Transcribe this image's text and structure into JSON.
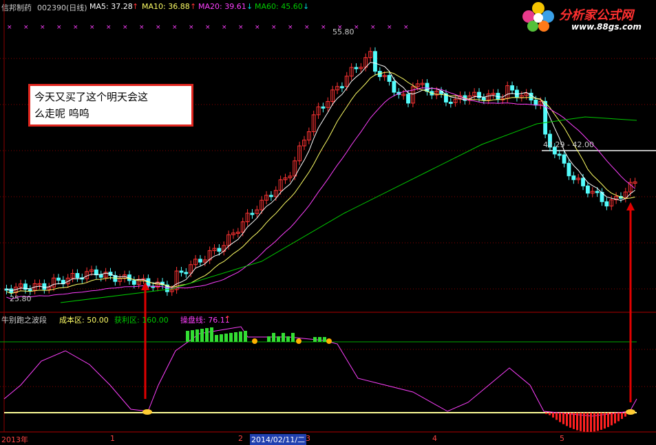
{
  "header": {
    "stock_name": "信邦制药",
    "stock_code": "002390(日线)",
    "ma5": "MA5: 37.28",
    "ma10": "MA10: 36.88",
    "ma20": "MA20: 39.61",
    "ma60": "MA60: 45.60",
    "up_arrow": "↑",
    "down_arrow": "↓"
  },
  "price_labels": {
    "high": "55.80",
    "low": "25.80",
    "range": "42.29 - 42.00"
  },
  "note": {
    "line1": "今天又买了这个明天会这",
    "line2": "么走呢 呜呜"
  },
  "sub_header": {
    "name": "牛别跑之波段",
    "cost": "成本区: 50.00",
    "profit": "获利区: 160.00",
    "operation": "操盘线: 76.11",
    "arrow": "↑"
  },
  "x_axis": {
    "labels": [
      "2013年",
      "1",
      "2",
      "2014/02/11/二",
      "3",
      "4",
      "5"
    ]
  },
  "logo": {
    "title": "分析家公式网",
    "url": "www.88gs.com"
  },
  "colors": {
    "up": "#ff3333",
    "down": "#54fcfc",
    "ma5": "#ffffff",
    "ma10": "#ffff66",
    "ma20": "#ff40ff",
    "ma60": "#00cc00",
    "grid": "#8b0000",
    "arrow": "#e00000"
  }
}
